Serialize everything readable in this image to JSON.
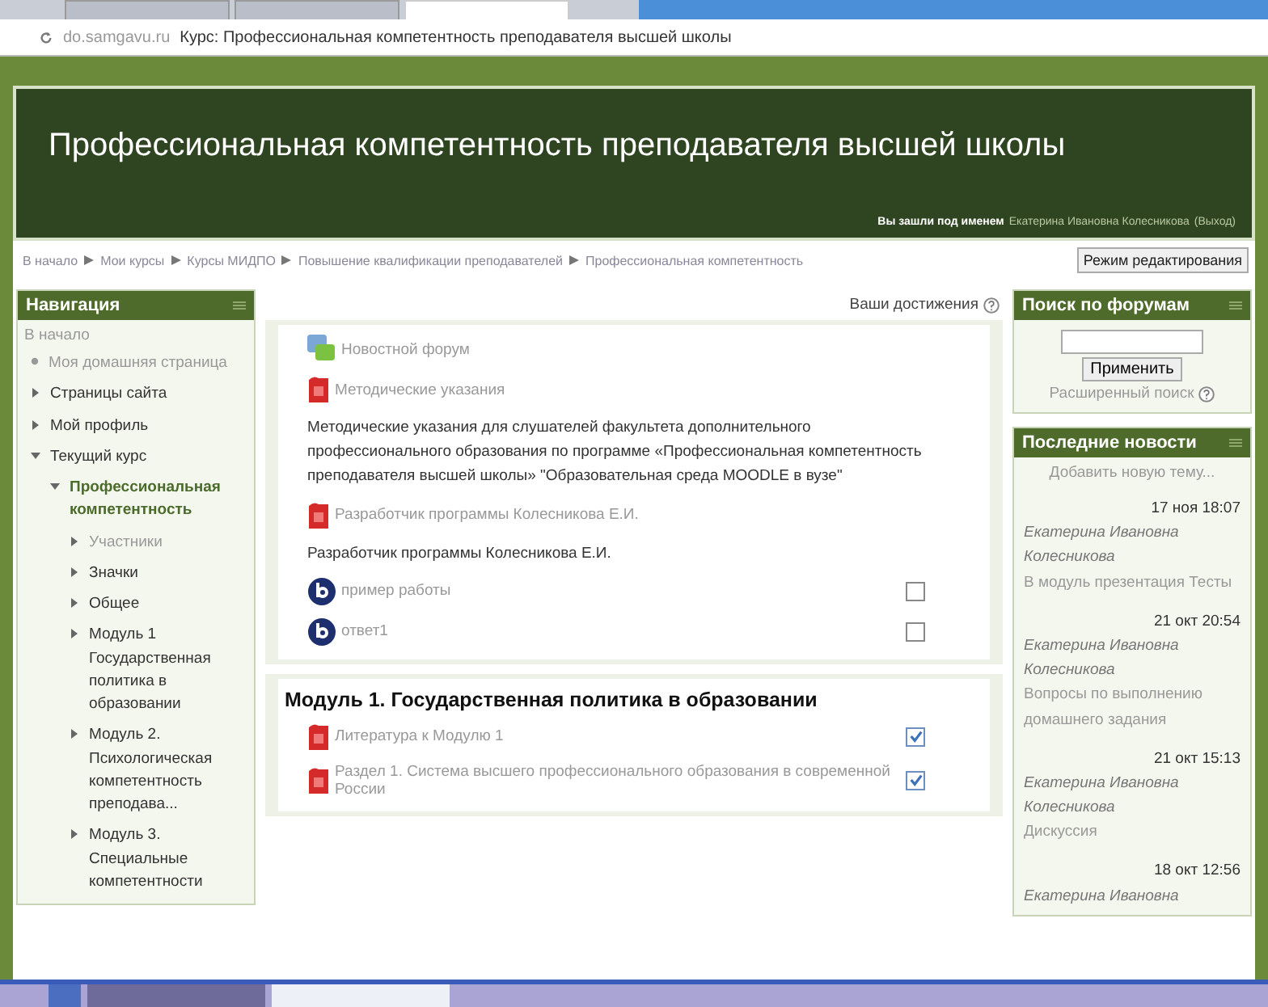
{
  "browser": {
    "tabs": [
      {
        "selected": false
      },
      {
        "selected": false
      },
      {
        "selected": true
      }
    ],
    "url": "do.samgavu.ru",
    "page_title": "Курс: Профессиональная компетентность преподавателя высшей школы"
  },
  "header": {
    "title": "Профессиональная компетентность преподавателя высшей школы",
    "login_label": "Вы зашли под именем",
    "user": "Екатерина Ивановна Колесникова",
    "logout": "(Выход)"
  },
  "breadcrumb": [
    "В начало",
    "Мои курсы",
    "Курсы МИДПО",
    "Повышение квалификации преподавателей",
    "Профессиональная компетентность"
  ],
  "edit_button": "Режим редактирования",
  "navigation": {
    "title": "Навигация",
    "home": "В начало",
    "items": [
      {
        "label": "Моя домашняя страница",
        "kind": "link"
      },
      {
        "label": "Страницы сайта",
        "kind": "branch",
        "expanded": false
      },
      {
        "label": "Мой профиль",
        "kind": "branch",
        "expanded": false
      },
      {
        "label": "Текущий курс",
        "kind": "branch",
        "expanded": true,
        "children": [
          {
            "label": "Профессиональная компетентность",
            "kind": "current",
            "expanded": true,
            "children": [
              {
                "label": "Участники",
                "kind": "link-branch",
                "expanded": false
              },
              {
                "label": "Значки",
                "kind": "branch",
                "expanded": false
              },
              {
                "label": "Общее",
                "kind": "branch",
                "expanded": false
              },
              {
                "label": "Модуль 1 Государственная политика в образовании",
                "kind": "branch",
                "expanded": false
              },
              {
                "label": "Модуль 2. Психологическая компетентность преподава...",
                "kind": "branch",
                "expanded": false
              },
              {
                "label": "Модуль 3. Специальные компетентности",
                "kind": "branch",
                "expanded": false
              }
            ]
          }
        ]
      }
    ]
  },
  "achievements": "Ваши достижения",
  "sections": [
    {
      "activities": [
        {
          "kind": "forum",
          "title": "Новостной форум"
        },
        {
          "kind": "file",
          "title": "Методические указания"
        },
        {
          "kind": "text",
          "text": "Методические указания для слушателей факультета  дополнительного профессионального  образования  по  программе «Профессиональная компетентность преподавателя высшей школы»  \"Образовательная среда MOODLE в вузе\""
        },
        {
          "kind": "file",
          "title": "Разработчик программы Колесникова Е.И."
        },
        {
          "kind": "text",
          "text": "Разработчик программы Колесникова Е.И."
        },
        {
          "kind": "page",
          "title": "пример работы",
          "checked": false
        },
        {
          "kind": "page",
          "title": "ответ1",
          "checked": false
        }
      ]
    },
    {
      "title": "Модуль 1. Государственная политика в образовании",
      "activities": [
        {
          "kind": "file",
          "title": "Литература к Модулю 1",
          "checked": true
        },
        {
          "kind": "file",
          "title": "Раздел 1. Система высшего профессионального образования в современной России",
          "checked": true
        }
      ]
    }
  ],
  "forum_search": {
    "title": "Поиск по форумам",
    "button": "Применить",
    "advanced": "Расширенный поиск"
  },
  "news": {
    "title": "Последние новости",
    "add": "Добавить новую тему...",
    "posts": [
      {
        "date": "17 ноя 18:07",
        "author": "Екатерина Ивановна Колесникова",
        "subject": "В модуль презентация Тесты"
      },
      {
        "date": "21 окт 20:54",
        "author": "Екатерина Ивановна Колесникова",
        "subject": "Вопросы по выполнению домашнего задания"
      },
      {
        "date": "21 окт 15:13",
        "author": "Екатерина Ивановна Колесникова",
        "subject": "Дискуссия"
      },
      {
        "date": "18 окт 12:56",
        "author": "Екатерина Ивановна"
      }
    ]
  }
}
